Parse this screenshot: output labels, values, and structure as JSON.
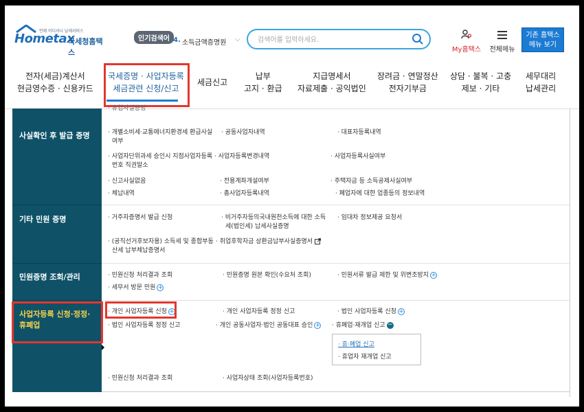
{
  "header": {
    "logo_sub": "언제 어디서나 납세서비스",
    "logo_main": "Hometax",
    "brand": "국세청홈택스",
    "popular_badge": "인기검색어",
    "popular_rank": "4.",
    "popular_term": "소득금액증명원",
    "search_placeholder": "검색어를 입력하세요.",
    "my_hometax": "My홈택스",
    "all_menu": "전체메뉴",
    "old_hometax_line1": "기존 홈택스",
    "old_hometax_line2": "메뉴 보기"
  },
  "gnb": [
    {
      "line1": "전자(세금)계산서",
      "line2": "현금영수증 · 신용카드"
    },
    {
      "line1": "국세증명 · 사업자등록",
      "line2": "세금관련 신청/신고"
    },
    {
      "line1": "세금신고",
      "line2": ""
    },
    {
      "line1": "납부",
      "line2": "고지 · 환급"
    },
    {
      "line1": "지급명세서",
      "line2": "자료제출 · 공익법인"
    },
    {
      "line1": "장려금 · 연말정산",
      "line2": "전자기부금"
    },
    {
      "line1": "상담 · 불복 · 고충",
      "line2": "제보 · 기타"
    },
    {
      "line1": "세무대리",
      "line2": "납세관리"
    }
  ],
  "categories": {
    "fact": "사실확인 후 발급 증명",
    "other": "기타 민원 증명",
    "inquiry": "민원증명 조회/관리",
    "business_line1": "사업자등록 신청·정정·",
    "business_line2": "휴폐업"
  },
  "items": {
    "top_cut": "· 휴업사실증명",
    "fact": [
      [
        "· 개별소비세·교통에너지환경세 환급사실",
        "여부"
      ],
      [
        "· 공동사업자내역"
      ],
      [
        "· 대표자등록내역"
      ],
      [
        "· 사업자단위과세 승인시 지점사업자등록",
        "번호 직권말소"
      ],
      [
        "· 사업자등록변경내역"
      ],
      [
        "· 사업자등록사실여부"
      ],
      [
        "· 신고사실없음"
      ],
      [
        "· 전용계좌개설여부"
      ],
      [
        "· 주택자금 등 소득공제사실여부"
      ],
      [
        "· 체납내역"
      ],
      [
        "· 총사업자등록내역"
      ],
      [
        "· 폐업자에 대한 업종등의 정보내역"
      ]
    ],
    "other": [
      [
        "· 거주자증명서 발급 신청"
      ],
      [
        "· 비거주자등의국내원천소득에 대한 소득",
        "세(법인세) 납세사실증명"
      ],
      [
        "· 임대차 정보제공 요청서"
      ],
      [
        "· (공직선거후보자용) 소득세 및 종합부동",
        "산세 납부체납증명서"
      ],
      [
        "· 취업후학자금 상환금납부사실증명서"
      ]
    ],
    "inquiry": [
      [
        "· 민원신청 처리결과 조회"
      ],
      [
        "· 민원증명 원본 확인(수요처 조회)"
      ],
      [
        "· 민원서류 발급 제한 및 위변조방지"
      ],
      [
        "· 세무서 방문 민원"
      ]
    ],
    "business": [
      [
        "· 개인 사업자등록 신청"
      ],
      [
        "· 개인 사업자등록 정정 신고"
      ],
      [
        "· 법인 사업자등록 신청"
      ],
      [
        "· 법인 사업자등록 정정 신고"
      ],
      [
        "· 개인 공동사업자·법인 공동대표 승인"
      ],
      [
        "· 휴폐업·재개업 신고"
      ]
    ],
    "submenu": [
      "· 휴·폐업 신고",
      "· 휴업자 재개업 신고"
    ],
    "bottom": [
      [
        "· 민원신청 처리결과 조회"
      ],
      [
        "· 사업자상태 조회(사업자등록번호)"
      ]
    ]
  }
}
